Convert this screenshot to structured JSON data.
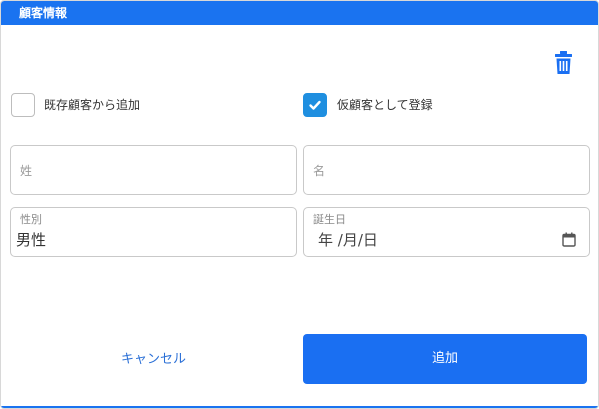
{
  "dialog": {
    "title": "顧客情報"
  },
  "toolbar": {
    "delete_icon": "trash-icon",
    "accent": "#1a73f0"
  },
  "options": {
    "existing_customer": {
      "label": "既存顧客から追加",
      "checked": false
    },
    "temporary_customer": {
      "label": "仮顧客として登録",
      "checked": true,
      "color": "#1f8fe0"
    }
  },
  "form": {
    "last_name": {
      "placeholder": "姓",
      "value": ""
    },
    "first_name": {
      "placeholder": "名",
      "value": ""
    },
    "gender": {
      "label": "性別",
      "value": "男性"
    },
    "birthdate": {
      "label": "誕生日",
      "value": "年 /月/日",
      "icon": "calendar-icon"
    }
  },
  "actions": {
    "cancel_label": "キャンセル",
    "add_label": "追加",
    "primary_color": "#1a6ff2"
  }
}
